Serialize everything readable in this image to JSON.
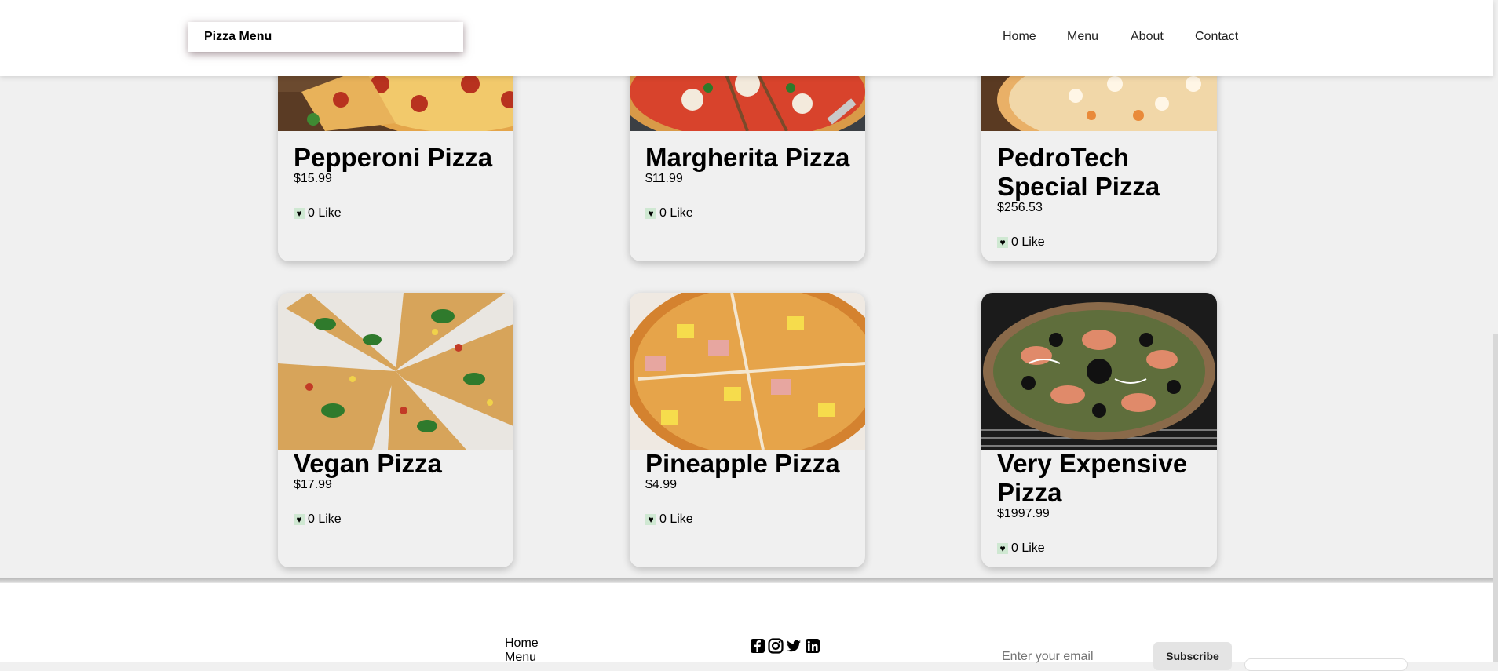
{
  "header": {
    "brand": "Pizza Menu",
    "nav": [
      "Home",
      "Menu",
      "About",
      "Contact"
    ]
  },
  "menu": {
    "items": [
      {
        "name": "Pepperoni Pizza",
        "price": "$15.99",
        "likes": "0 Like"
      },
      {
        "name": "Margherita Pizza",
        "price": "$11.99",
        "likes": "0 Like"
      },
      {
        "name": "PedroTech Special Pizza",
        "price": "$256.53",
        "likes": "0 Like"
      },
      {
        "name": "Vegan Pizza",
        "price": "$17.99",
        "likes": "0 Like"
      },
      {
        "name": "Pineapple Pizza",
        "price": "$4.99",
        "likes": "0 Like"
      },
      {
        "name": "Very Expensive Pizza",
        "price": "$1997.99",
        "likes": "0 Like"
      }
    ]
  },
  "footer": {
    "links": [
      "Home",
      "Menu"
    ],
    "social": [
      "facebook-icon",
      "instagram-icon",
      "twitter-icon",
      "linkedin-icon"
    ],
    "email_placeholder": "Enter your email",
    "subscribe_label": "Subscribe"
  },
  "colors": {
    "page_bg": "#f0f0f0",
    "like_icon_bg": "#cfe8d2"
  }
}
